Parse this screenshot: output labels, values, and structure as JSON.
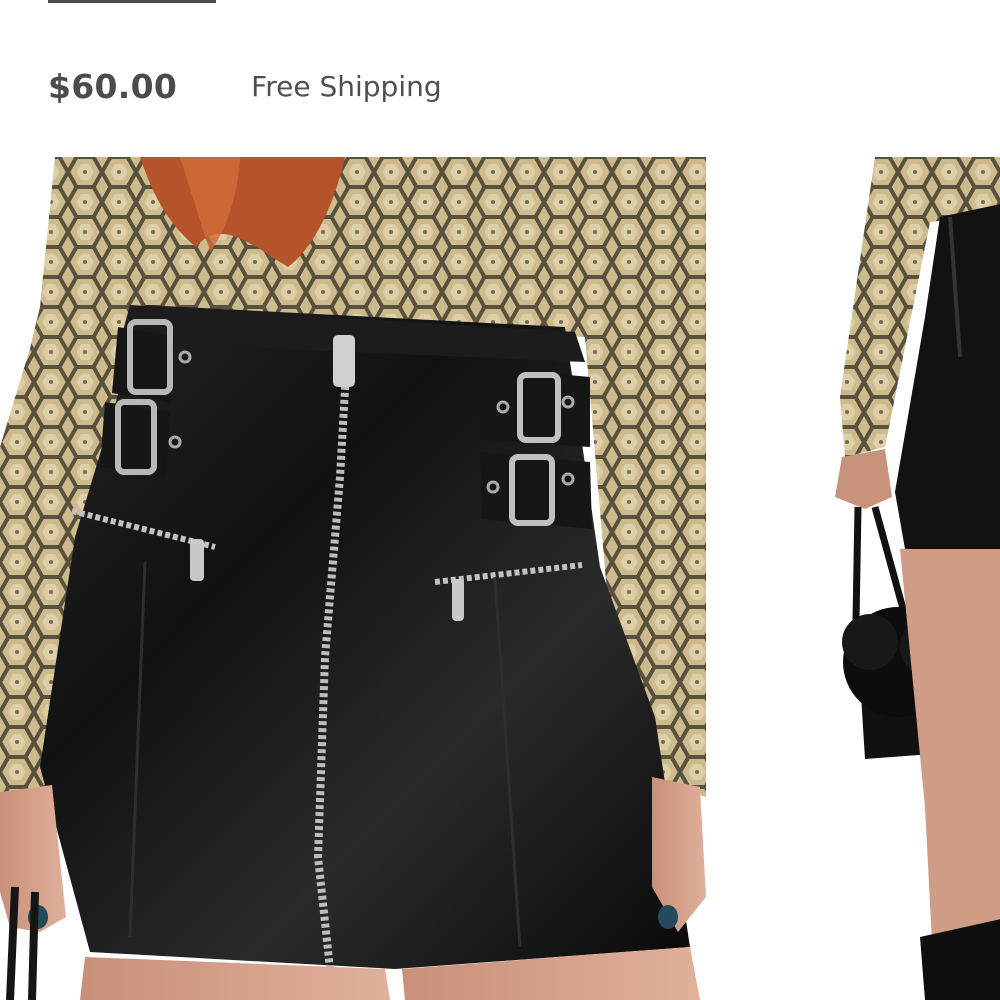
{
  "product": {
    "price": "$60.00",
    "shipping_label": "Free Shipping"
  },
  "gallery": {
    "images": [
      {
        "name": "product-image-front"
      },
      {
        "name": "product-image-side"
      }
    ]
  },
  "colors": {
    "text_dark": "#4b4b4b",
    "skirt_black": "#111111",
    "snake_print": "#c9b88f"
  }
}
